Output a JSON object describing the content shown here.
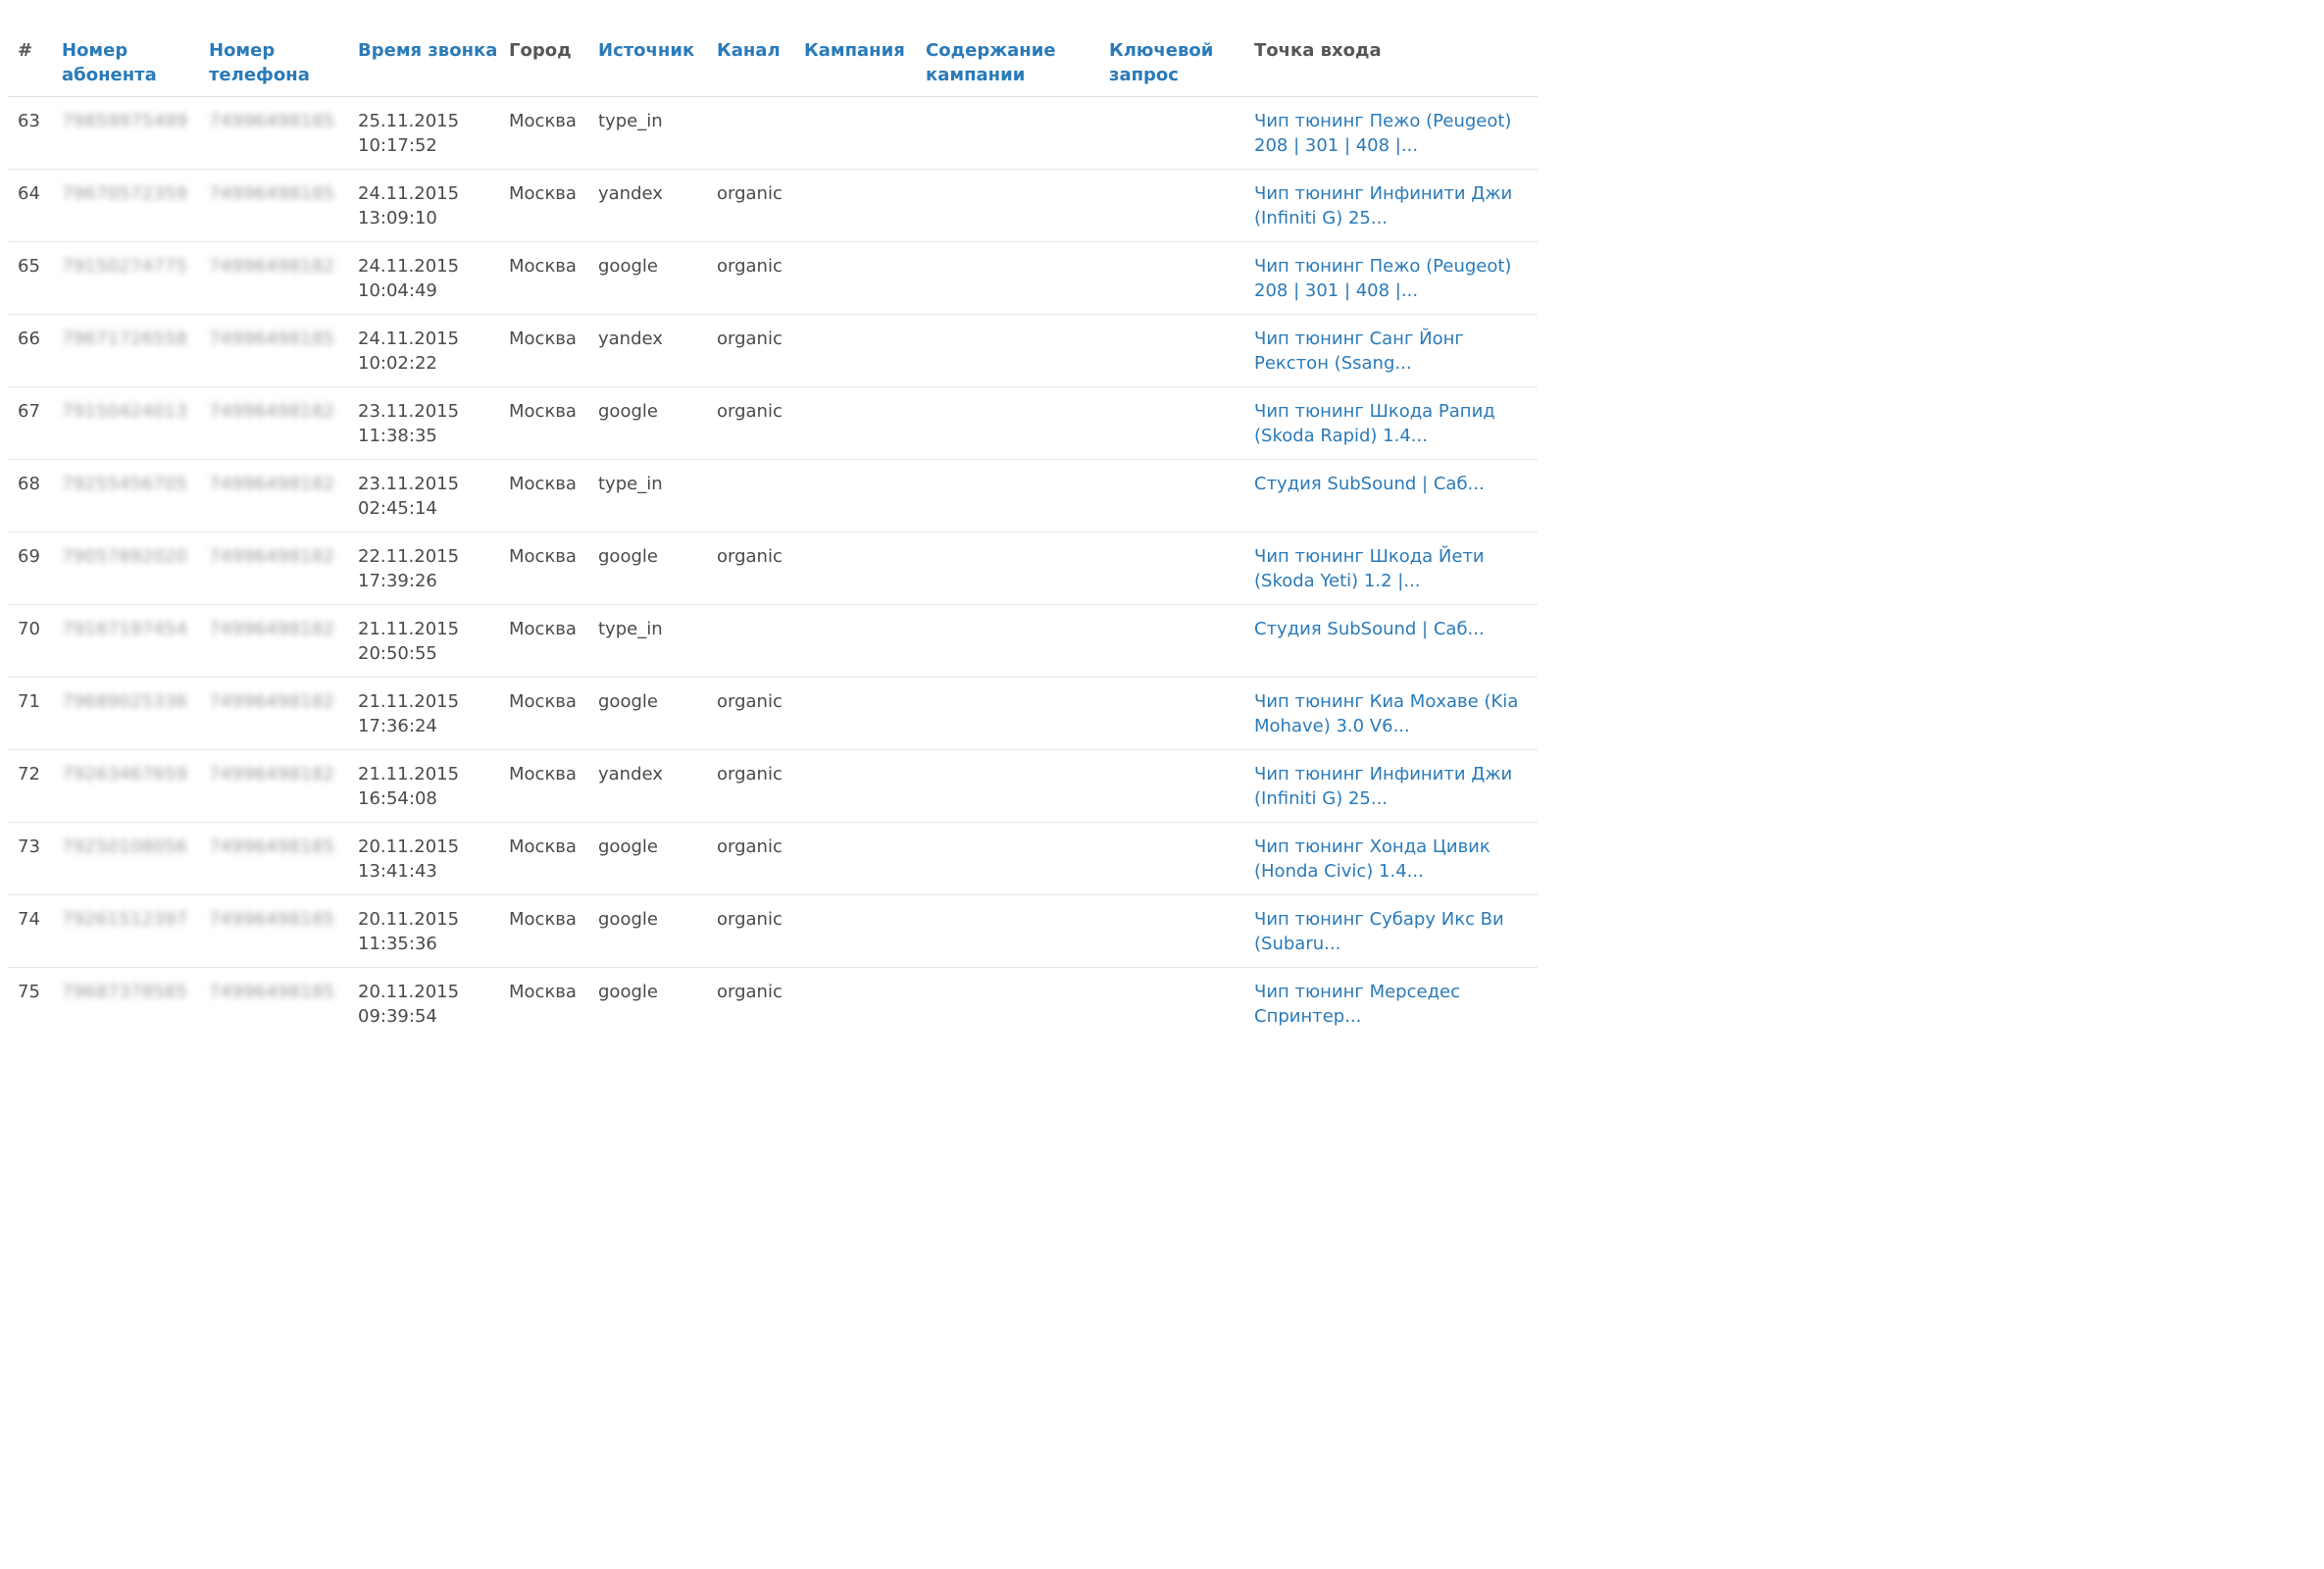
{
  "table": {
    "headers": [
      {
        "key": "num",
        "label": "#",
        "sortable": false
      },
      {
        "key": "subscriber",
        "label": "Номер абонента",
        "sortable": true
      },
      {
        "key": "phone",
        "label": "Номер телефона",
        "sortable": true
      },
      {
        "key": "time",
        "label": "Время звонка",
        "sortable": true
      },
      {
        "key": "city",
        "label": "Город",
        "sortable": false
      },
      {
        "key": "source",
        "label": "Источник",
        "sortable": true
      },
      {
        "key": "channel",
        "label": "Канал",
        "sortable": true
      },
      {
        "key": "campaign",
        "label": "Кампания",
        "sortable": true
      },
      {
        "key": "content",
        "label": "Содержание кампании",
        "sortable": true
      },
      {
        "key": "keyword",
        "label": "Ключевой запрос",
        "sortable": true
      },
      {
        "key": "entry",
        "label": "Точка входа",
        "sortable": false
      }
    ],
    "rows": [
      {
        "num": "63",
        "subscriber": "79859975499",
        "phone": "74996498185",
        "date": "25.11.2015",
        "clock": "10:17:52",
        "city": "Москва",
        "source": "type_in",
        "channel": "",
        "campaign": "",
        "content": "",
        "keyword": "",
        "entry_line1": "Чип тюнинг Пежо (Peugeot)",
        "entry_line2": "208 | 301 | 408 |..."
      },
      {
        "num": "64",
        "subscriber": "79670572359",
        "phone": "74996498185",
        "date": "24.11.2015",
        "clock": "13:09:10",
        "city": "Москва",
        "source": "yandex",
        "channel": "organic",
        "campaign": "",
        "content": "",
        "keyword": "",
        "entry_line1": "Чип тюнинг Инфинити Джи",
        "entry_line2": "(Infiniti G) 25..."
      },
      {
        "num": "65",
        "subscriber": "79150274775",
        "phone": "74996498182",
        "date": "24.11.2015",
        "clock": "10:04:49",
        "city": "Москва",
        "source": "google",
        "channel": "organic",
        "campaign": "",
        "content": "",
        "keyword": "",
        "entry_line1": "Чип тюнинг Пежо (Peugeot)",
        "entry_line2": "208 | 301 | 408 |..."
      },
      {
        "num": "66",
        "subscriber": "79671726558",
        "phone": "74996498185",
        "date": "24.11.2015",
        "clock": "10:02:22",
        "city": "Москва",
        "source": "yandex",
        "channel": "organic",
        "campaign": "",
        "content": "",
        "keyword": "",
        "entry_line1": "Чип тюнинг Санг Йонг",
        "entry_line2": "Рекстон (Ssang..."
      },
      {
        "num": "67",
        "subscriber": "79150424013",
        "phone": "74996498182",
        "date": "23.11.2015",
        "clock": "11:38:35",
        "city": "Москва",
        "source": "google",
        "channel": "organic",
        "campaign": "",
        "content": "",
        "keyword": "",
        "entry_line1": "Чип тюнинг Шкода Рапид",
        "entry_line2": "(Skoda Rapid) 1.4..."
      },
      {
        "num": "68",
        "subscriber": "79255456705",
        "phone": "74996498182",
        "date": "23.11.2015",
        "clock": "02:45:14",
        "city": "Москва",
        "source": "type_in",
        "channel": "",
        "campaign": "",
        "content": "",
        "keyword": "",
        "entry_line1": "Студия SubSound | Саб...",
        "entry_line2": ""
      },
      {
        "num": "69",
        "subscriber": "79057892020",
        "phone": "74996498182",
        "date": "22.11.2015",
        "clock": "17:39:26",
        "city": "Москва",
        "source": "google",
        "channel": "organic",
        "campaign": "",
        "content": "",
        "keyword": "",
        "entry_line1": "Чип тюнинг Шкода Йети",
        "entry_line2": "(Skoda Yeti) 1.2 |..."
      },
      {
        "num": "70",
        "subscriber": "79167197454",
        "phone": "74996498182",
        "date": "21.11.2015",
        "clock": "20:50:55",
        "city": "Москва",
        "source": "type_in",
        "channel": "",
        "campaign": "",
        "content": "",
        "keyword": "",
        "entry_line1": "Студия SubSound | Саб...",
        "entry_line2": ""
      },
      {
        "num": "71",
        "subscriber": "79689025336",
        "phone": "74996498182",
        "date": "21.11.2015",
        "clock": "17:36:24",
        "city": "Москва",
        "source": "google",
        "channel": "organic",
        "campaign": "",
        "content": "",
        "keyword": "",
        "entry_line1": "Чип тюнинг Киа Мохаве (Kia",
        "entry_line2": "Mohave) 3.0 V6..."
      },
      {
        "num": "72",
        "subscriber": "79263467659",
        "phone": "74996498182",
        "date": "21.11.2015",
        "clock": "16:54:08",
        "city": "Москва",
        "source": "yandex",
        "channel": "organic",
        "campaign": "",
        "content": "",
        "keyword": "",
        "entry_line1": "Чип тюнинг Инфинити Джи",
        "entry_line2": "(Infiniti G) 25..."
      },
      {
        "num": "73",
        "subscriber": "79250108056",
        "phone": "74996498185",
        "date": "20.11.2015",
        "clock": "13:41:43",
        "city": "Москва",
        "source": "google",
        "channel": "organic",
        "campaign": "",
        "content": "",
        "keyword": "",
        "entry_line1": "Чип тюнинг Хонда Цивик",
        "entry_line2": "(Honda Civic) 1.4..."
      },
      {
        "num": "74",
        "subscriber": "79261512397",
        "phone": "74996498185",
        "date": "20.11.2015",
        "clock": "11:35:36",
        "city": "Москва",
        "source": "google",
        "channel": "organic",
        "campaign": "",
        "content": "",
        "keyword": "",
        "entry_line1": "Чип тюнинг Субару Икс Ви",
        "entry_line2": "(Subaru..."
      },
      {
        "num": "75",
        "subscriber": "79687378585",
        "phone": "74996498185",
        "date": "20.11.2015",
        "clock": "09:39:54",
        "city": "Москва",
        "source": "google",
        "channel": "organic",
        "campaign": "",
        "content": "",
        "keyword": "",
        "entry_line1": "Чип тюнинг Мерседес",
        "entry_line2": "Спринтер..."
      }
    ]
  },
  "colors": {
    "link": "#2a7ab9",
    "header_plain": "#555555",
    "text": "#4a4a4a",
    "row_border": "#e6e6e6"
  }
}
